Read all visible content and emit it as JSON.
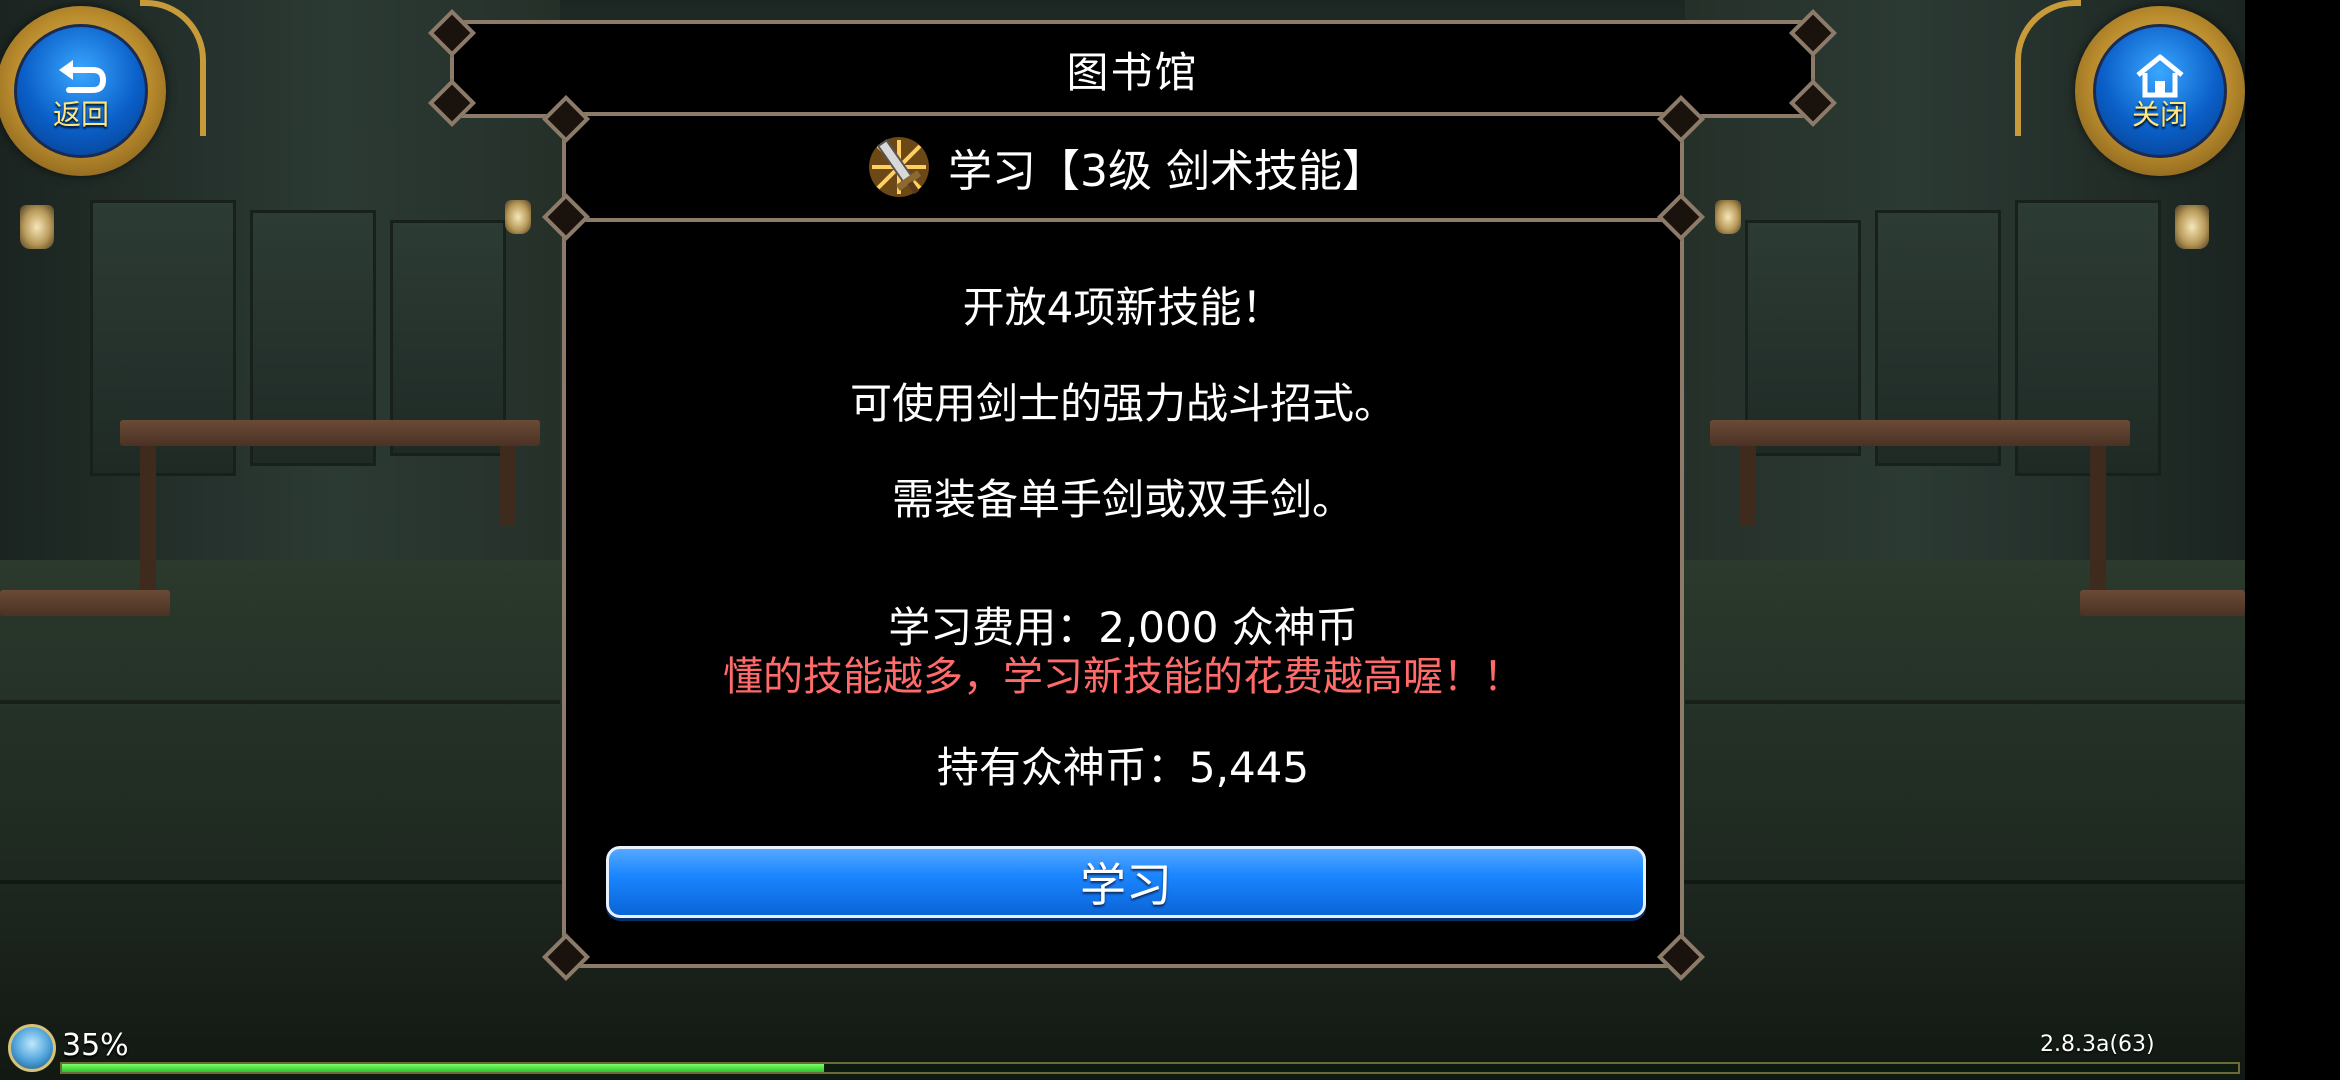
{
  "screen": {
    "title": "图书馆"
  },
  "nav": {
    "back_label": "返回",
    "close_label": "关闭"
  },
  "dialog": {
    "header": "学习【3级  剑术技能】",
    "line1": "开放4项新技能！",
    "line2": "可使用剑士的强力战斗招式。",
    "line3": "需装备单手剑或双手剑。",
    "cost": "学习费用：2,000 众神币",
    "warning": "懂的技能越多，学习新技能的花费越高喔！！",
    "owned": "持有众神币：5,445",
    "learn_button": "学习"
  },
  "status": {
    "loading_percent_text": "35%",
    "loading_progress": 0.35,
    "version": "2.8.3a(63)"
  },
  "icons": {
    "back": "back-arrow-icon",
    "close": "home-icon",
    "skill": "sword-skill-icon",
    "loading": "loading-orb-icon"
  },
  "colors": {
    "warning_text": "#ff6a6a",
    "learn_button": "#1a86ff",
    "nav_label": "#ffe680",
    "progress_fill": "#2cc42a"
  }
}
